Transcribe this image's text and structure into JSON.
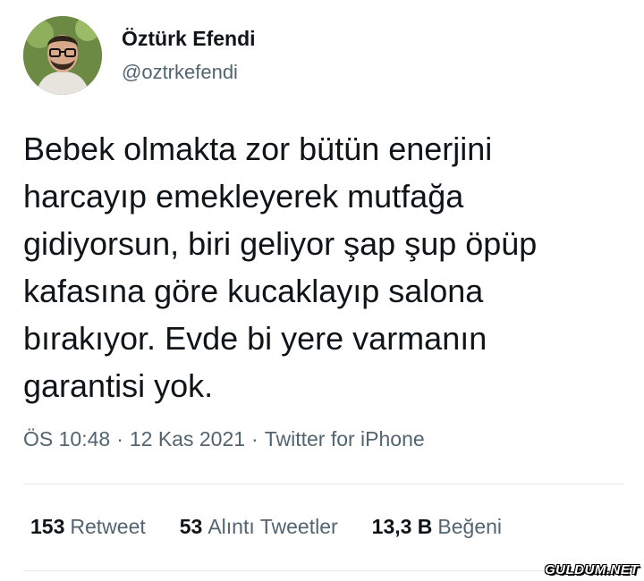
{
  "author": {
    "display_name": "Öztürk Efendi",
    "handle": "@oztrkefendi",
    "avatar": "profile-photo"
  },
  "tweet": {
    "lines": [
      "Bebek olmakta zor bütün enerjini",
      "harcayıp emekleyerek mutfağa",
      "gidiyorsun, biri geliyor şap şup öpüp",
      "kafasına göre kucaklayıp salona",
      "bırakıyor. Evde bi yere varmanın",
      "garantisi yok."
    ],
    "time": "ÖS 10:48",
    "date": "12 Kas 2021",
    "source": "Twitter for iPhone",
    "separator": "·"
  },
  "stats": {
    "retweets": {
      "count": "153",
      "label": "Retweet"
    },
    "quotes": {
      "count": "53",
      "label": "Alıntı Tweetler"
    },
    "likes": {
      "count": "13,3 B",
      "label": "Beğeni"
    }
  },
  "watermark": "GULDUM.NET",
  "colors": {
    "text": "#0f1419",
    "secondary": "#536471",
    "divider": "#e6ecf0"
  }
}
